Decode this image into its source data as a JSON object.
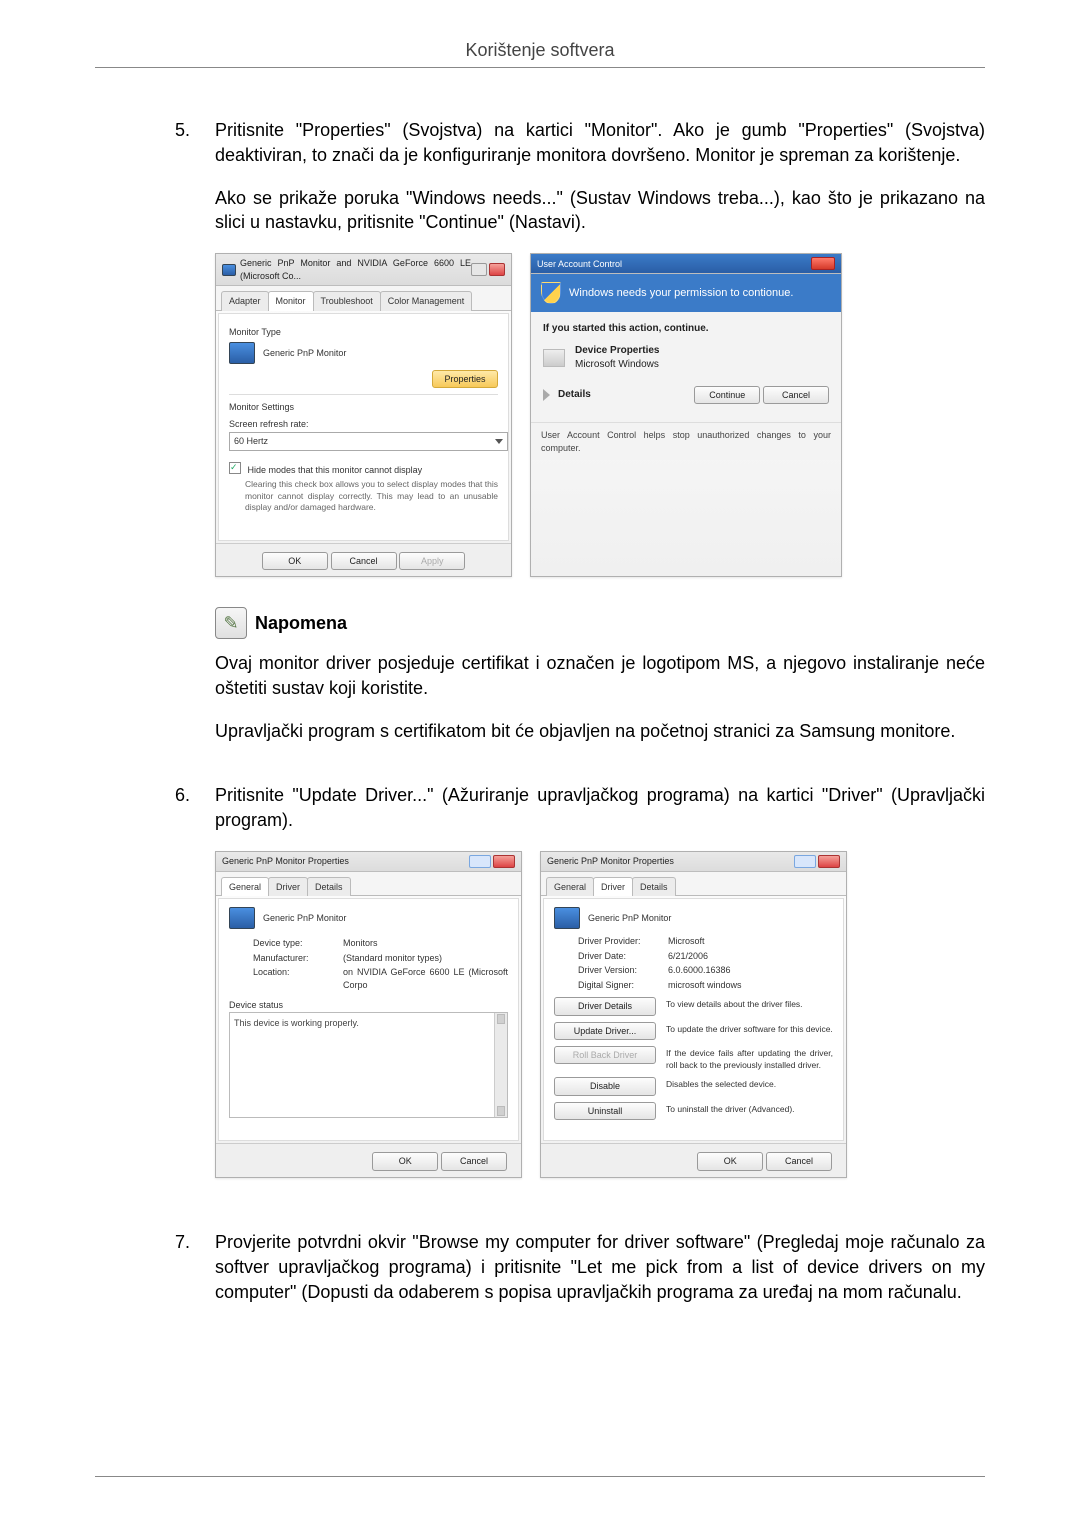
{
  "header": {
    "title": "Korištenje softvera"
  },
  "steps": {
    "s5": {
      "num": "5.",
      "p1": "Pritisnite \"Properties\" (Svojstva) na kartici \"Monitor\". Ako je gumb \"Properties\" (Svojstva) deaktiviran, to znači da je konfiguriranje monitora dovršeno. Monitor je spreman za korištenje.",
      "p2": "Ako se prikaže poruka \"Windows needs...\" (Sustav Windows treba...), kao što je prikazano na slici u nastavku, pritisnite \"Continue\" (Nastavi)."
    },
    "s6": {
      "num": "6.",
      "p1": "Pritisnite \"Update Driver...\" (Ažuriranje upravljačkog programa) na kartici \"Driver\" (Upravljački program)."
    },
    "s7": {
      "num": "7.",
      "p1": "Provjerite potvrdni okvir \"Browse my computer for driver software\" (Pregledaj moje računalo za softver upravljačkog programa) i pritisnite \"Let me pick from a list of device drivers on my computer\" (Dopusti da odaberem s popisa upravljačkih programa za uređaj na mom računalu."
    }
  },
  "note": {
    "title": "Napomena",
    "p1": "Ovaj monitor driver posjeduje certifikat i označen je logotipom MS, a njegovo instaliranje neće oštetiti sustav koji koristite.",
    "p2": "Upravljački program s certifikatom bit će objavljen na početnoj stranici za Samsung monitore."
  },
  "fig1": {
    "title": "Generic PnP Monitor and NVIDIA GeForce 6600 LE (Microsoft Co...",
    "tabs": {
      "adapter": "Adapter",
      "monitor": "Monitor",
      "troubleshoot": "Troubleshoot",
      "color": "Color Management"
    },
    "monitor_type_label": "Monitor Type",
    "monitor_type_value": "Generic PnP Monitor",
    "properties_btn": "Properties",
    "monitor_settings_label": "Monitor Settings",
    "refresh_label": "Screen refresh rate:",
    "refresh_value": "60 Hertz",
    "hide_modes_label": "Hide modes that this monitor cannot display",
    "hide_modes_desc": "Clearing this check box allows you to select display modes that this monitor cannot display correctly. This may lead to an unusable display and/or damaged hardware.",
    "ok": "OK",
    "cancel": "Cancel",
    "apply": "Apply"
  },
  "fig2": {
    "title": "User Account Control",
    "headline": "Windows needs your permission to contionue.",
    "instr": "If you started this action, continue.",
    "prog_name": "Device Properties",
    "publisher": "Microsoft Windows",
    "details": "Details",
    "continue": "Continue",
    "cancel": "Cancel",
    "footer": "User Account Control helps stop unauthorized changes to your computer."
  },
  "fig3": {
    "title": "Generic PnP Monitor Properties",
    "tabs": {
      "general": "General",
      "driver": "Driver",
      "details": "Details"
    },
    "name": "Generic PnP Monitor",
    "rows": {
      "devtype_k": "Device type:",
      "devtype_v": "Monitors",
      "manu_k": "Manufacturer:",
      "manu_v": "(Standard monitor types)",
      "loc_k": "Location:",
      "loc_v": "on NVIDIA GeForce 6600 LE (Microsoft Corpo"
    },
    "status_label": "Device status",
    "status_text": "This device is working properly.",
    "ok": "OK",
    "cancel": "Cancel"
  },
  "fig4": {
    "title": "Generic PnP Monitor Properties",
    "tabs": {
      "general": "General",
      "driver": "Driver",
      "details": "Details"
    },
    "name": "Generic PnP Monitor",
    "rows": {
      "prov_k": "Driver Provider:",
      "prov_v": "Microsoft",
      "date_k": "Driver Date:",
      "date_v": "6/21/2006",
      "ver_k": "Driver Version:",
      "ver_v": "6.0.6000.16386",
      "sig_k": "Digital Signer:",
      "sig_v": "microsoft windows"
    },
    "btns": {
      "details": "Driver Details",
      "details_d": "To view details about the driver files.",
      "update": "Update Driver...",
      "update_d": "To update the driver software for this device.",
      "rollback": "Roll Back Driver",
      "rollback_d": "If the device fails after updating the driver, roll back to the previously installed driver.",
      "disable": "Disable",
      "disable_d": "Disables the selected device.",
      "uninstall": "Uninstall",
      "uninstall_d": "To uninstall the driver (Advanced)."
    },
    "ok": "OK",
    "cancel": "Cancel"
  }
}
